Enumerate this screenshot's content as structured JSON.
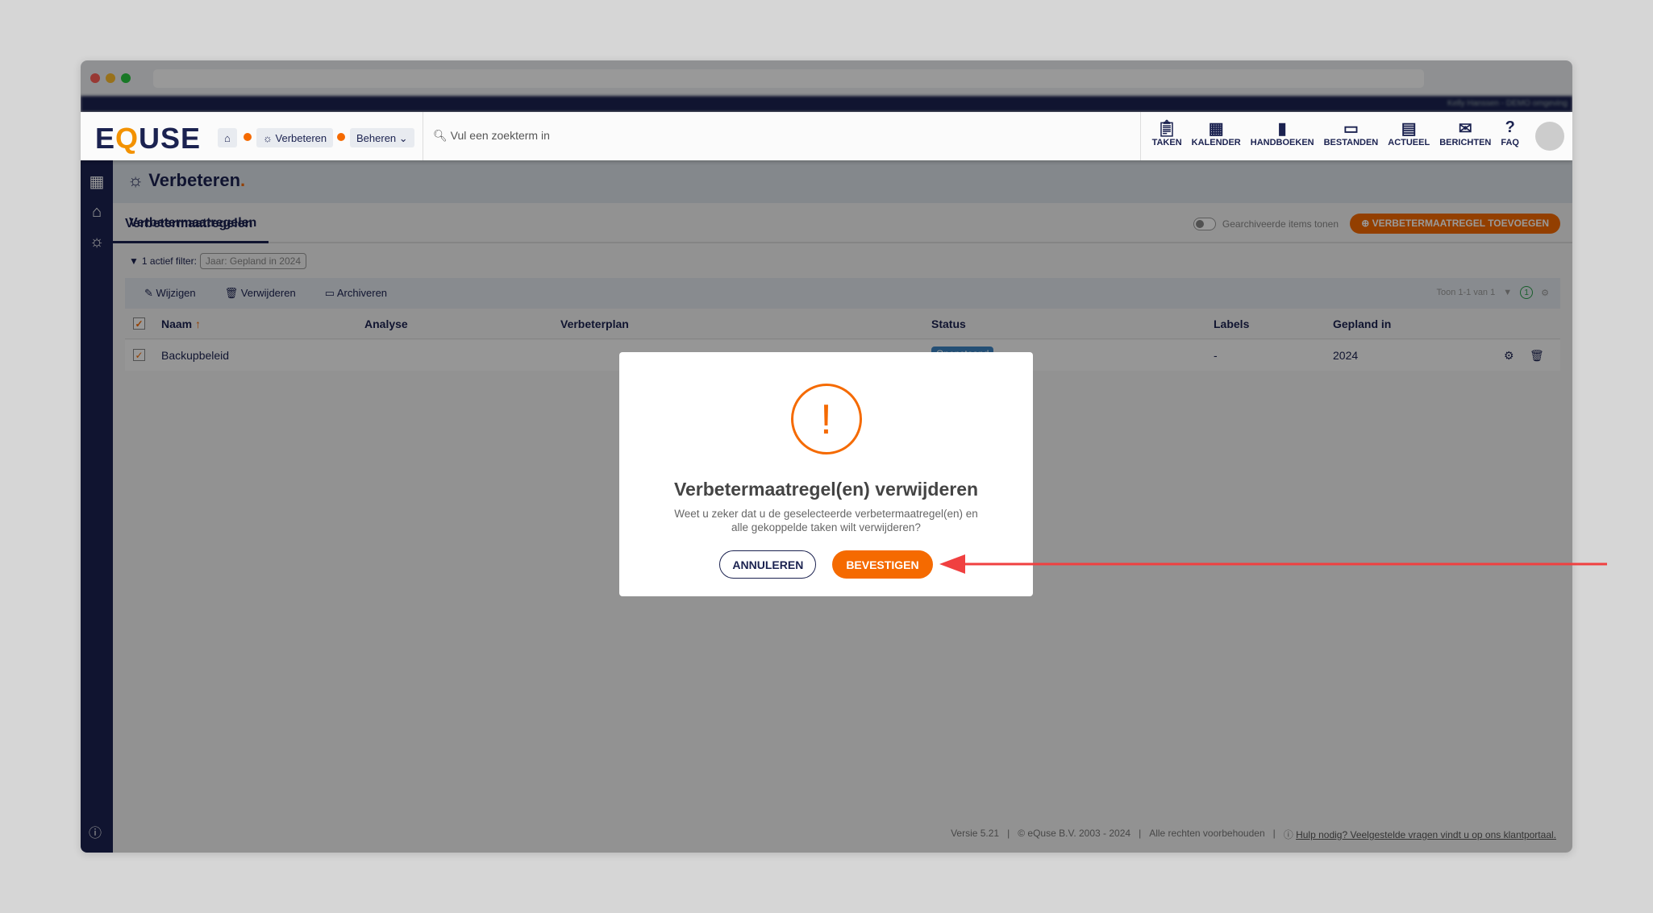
{
  "header": {
    "logo": "EQUSE",
    "breadcrumb": [
      "Verbeteren",
      "Beheren"
    ],
    "search_placeholder": "Vul een zoekterm in",
    "user": "Kelly Hanssen - DEMO omgeving",
    "nav": [
      {
        "icon": "clipboard-icon",
        "label": "TAKEN"
      },
      {
        "icon": "calendar-icon",
        "label": "KALENDER"
      },
      {
        "icon": "book-icon",
        "label": "HANDBOEKEN"
      },
      {
        "icon": "archive-icon",
        "label": "BESTANDEN"
      },
      {
        "icon": "newspaper-icon",
        "label": "ACTUEEL"
      },
      {
        "icon": "chat-icon",
        "label": "BERICHTEN"
      },
      {
        "icon": "question-icon",
        "label": "FAQ"
      }
    ]
  },
  "page": {
    "title": "Verbeteren",
    "tab": "Verbetermaatregelen",
    "section": "Verbetermaatregelen",
    "archived_toggle": "Gearchiveerde items tonen",
    "add_button": "VERBETERMAATREGEL TOEVOEGEN",
    "filter_label": "1 actief filter:",
    "filter_chip": "Jaar: Gepland in 2024",
    "toolbar": {
      "edit": "Wijzigen",
      "delete": "Verwijderen",
      "archive": "Archiveren",
      "count": "Toon 1-1 van 1",
      "filter_count": "1"
    },
    "columns": [
      "Naam",
      "Analyse",
      "Verbeterplan",
      "Status",
      "Labels",
      "Gepland in"
    ],
    "rows": [
      {
        "naam": "Backupbeleid",
        "status": "Openstaand",
        "labels": "-",
        "gepland": "2024"
      }
    ]
  },
  "footer": {
    "version": "Versie 5.21",
    "copyright": "© eQuse B.V. 2003 - 2024",
    "rights": "Alle rechten voorbehouden",
    "help": "Hulp nodig? Veelgestelde vragen vindt u op ons klantportaal."
  },
  "modal": {
    "title": "Verbetermaatregel(en) verwijderen",
    "body": "Weet u zeker dat u de geselecteerde verbetermaatregel(en) en alle gekoppelde taken wilt verwijderen?",
    "cancel": "ANNULEREN",
    "confirm": "BEVESTIGEN"
  }
}
